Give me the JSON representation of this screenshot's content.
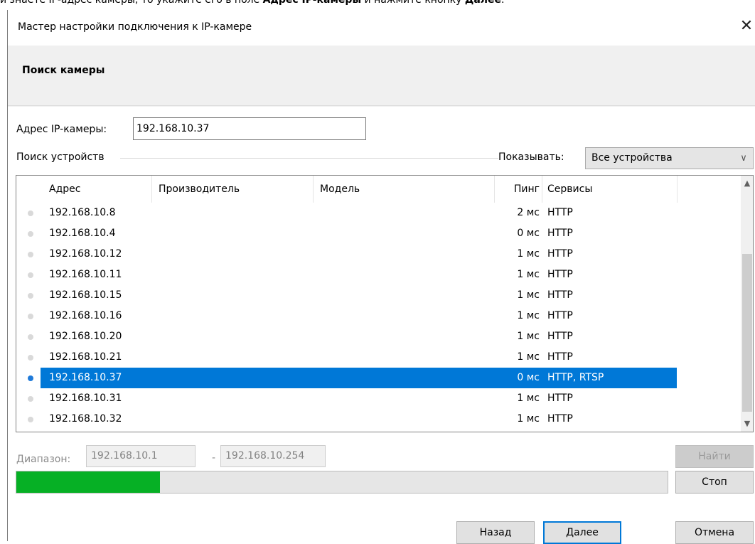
{
  "caption": {
    "prefix": "и знаете IP-адрес камеры, то укажите его в поле ",
    "bold1": "Адрес IP-камеры",
    "middle": " и нажмите кнопку ",
    "bold2": "Далее",
    "suffix": "."
  },
  "window": {
    "title": "Мастер настройки подключения к IP-камере",
    "close_glyph": "✕"
  },
  "header": {
    "title": "Поиск камеры"
  },
  "address": {
    "label": "Адрес IP-камеры:",
    "value": "192.168.10.37"
  },
  "search": {
    "group_label": "Поиск устройств",
    "show_label": "Показывать:",
    "show_value": "Все устройства"
  },
  "table": {
    "columns": {
      "address": "Адрес",
      "vendor": "Производитель",
      "model": "Модель",
      "ping": "Пинг",
      "services": "Сервисы"
    },
    "rows": [
      {
        "address": "192.168.10.8",
        "ping": "2 мс",
        "services": "HTTP"
      },
      {
        "address": "192.168.10.4",
        "ping": "0 мс",
        "services": "HTTP"
      },
      {
        "address": "192.168.10.12",
        "ping": "1 мс",
        "services": "HTTP"
      },
      {
        "address": "192.168.10.11",
        "ping": "1 мс",
        "services": "HTTP"
      },
      {
        "address": "192.168.10.15",
        "ping": "1 мс",
        "services": "HTTP"
      },
      {
        "address": "192.168.10.16",
        "ping": "1 мс",
        "services": "HTTP"
      },
      {
        "address": "192.168.10.20",
        "ping": "1 мс",
        "services": "HTTP"
      },
      {
        "address": "192.168.10.21",
        "ping": "1 мс",
        "services": "HTTP"
      },
      {
        "address": "192.168.10.37",
        "ping": "0 мс",
        "services": "HTTP, RTSP"
      },
      {
        "address": "192.168.10.31",
        "ping": "1 мс",
        "services": "HTTP"
      },
      {
        "address": "192.168.10.32",
        "ping": "1 мс",
        "services": "HTTP"
      }
    ],
    "selected_index": 8
  },
  "range": {
    "label": "Диапазон:",
    "from": "192.168.10.1",
    "separator": "-",
    "to": "192.168.10.254"
  },
  "progress": {
    "fraction": 0.22
  },
  "buttons": {
    "find": "Найти",
    "stop": "Стоп",
    "back": "Назад",
    "next": "Далее",
    "cancel": "Отмена"
  },
  "colors": {
    "selection": "#0078d7",
    "progress_fill": "#06b025",
    "status_dot_idle": "#d9d9d9",
    "status_dot_active": "#1f7ad9"
  }
}
